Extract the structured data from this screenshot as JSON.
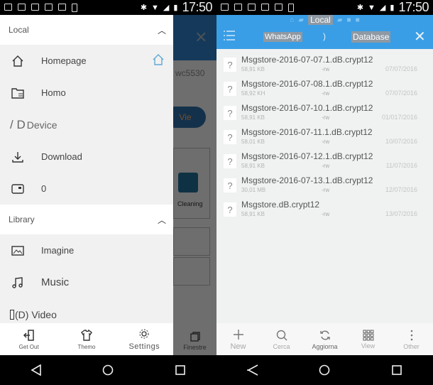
{
  "status_bar": {
    "time": "17:50",
    "notification_icons": [
      "image-icon",
      "calendar-icon",
      "gmail-icon",
      "youtube-icon",
      "mail-icon",
      "download-icon"
    ],
    "system_icons": [
      "bluetooth-icon",
      "wifi-icon",
      "signal-icon",
      "battery-icon"
    ]
  },
  "left_screen": {
    "background_app": {
      "partial_text": "wc5530",
      "pill_label": "Vie",
      "cleaning_label": "Cleaning",
      "windows_label": "Finestre"
    },
    "drawer": {
      "sections": [
        {
          "title": "Local",
          "expanded": true,
          "items": [
            {
              "label": "Homepage",
              "icon": "home-icon",
              "has_home_shortcut": true
            },
            {
              "label": "Homo",
              "icon": "folder-list-icon"
            },
            {
              "label": "Device",
              "icon": "device-icon",
              "prefix": "/ D"
            },
            {
              "label": "Download",
              "icon": "download-icon"
            },
            {
              "label": "0",
              "icon": "sd-card-icon"
            }
          ]
        },
        {
          "title": "Library",
          "expanded": true,
          "items": [
            {
              "label": "Imagine",
              "icon": "image-icon"
            },
            {
              "label": "Music",
              "icon": "music-icon"
            },
            {
              "label": "(D) Video",
              "icon": "video-icon"
            }
          ]
        }
      ],
      "footer": [
        {
          "label": "Get Out",
          "icon": "exit-icon"
        },
        {
          "label": "Themo",
          "icon": "shirt-icon"
        },
        {
          "label": "Settings",
          "icon": "settings-icon"
        }
      ]
    }
  },
  "right_screen": {
    "header": {
      "root_label": "Local",
      "path": [
        "WhatsApp",
        "Database"
      ],
      "separator": ")"
    },
    "files": [
      {
        "name": "Msgstore-2016-07-07.1.dB.crypt12",
        "size": "58,91 KB",
        "perm": "-rw",
        "date": "07/07/2016"
      },
      {
        "name": "Msgstore-2016-07-08.1.dB.crypt12",
        "size": "58,92 KH",
        "perm": "-rw",
        "date": "07/07/2016"
      },
      {
        "name": "Msgstore-2016-07-10.1.dB.crypt12",
        "size": "58,91 KB",
        "perm": "-rw",
        "date": "01/017/2016"
      },
      {
        "name": "Msgstore-2016-07-11.1.dB.crypt12",
        "size": "58,01 KB",
        "perm": "-rw",
        "date": "10/07/2016"
      },
      {
        "name": "Msgstore-2016-07-12.1.dB.crypt12",
        "size": "58,91 KB",
        "perm": "-rw",
        "date": "11/07/2016"
      },
      {
        "name": "Msgstore-2016-07-13.1.dB.crypt12",
        "size": "30,01 MB",
        "perm": "-rw",
        "date": "12/07/2016"
      },
      {
        "name": "Msgstore.dB.crypt12",
        "size": "58,91 KB",
        "perm": "-rw",
        "date": "13/07/2016"
      }
    ],
    "footer": [
      {
        "label": "New",
        "icon": "plus-icon"
      },
      {
        "label": "Cerca",
        "icon": "search-icon"
      },
      {
        "label": "Aggiorna",
        "icon": "refresh-icon"
      },
      {
        "label": "View",
        "icon": "grid-icon"
      },
      {
        "label": "Other",
        "icon": "more-vertical-icon"
      }
    ]
  },
  "colors": {
    "accent_blue": "#3a9ee6",
    "drawer_bg": "#f1f1f1",
    "home_shortcut": "#5fa9d6"
  }
}
